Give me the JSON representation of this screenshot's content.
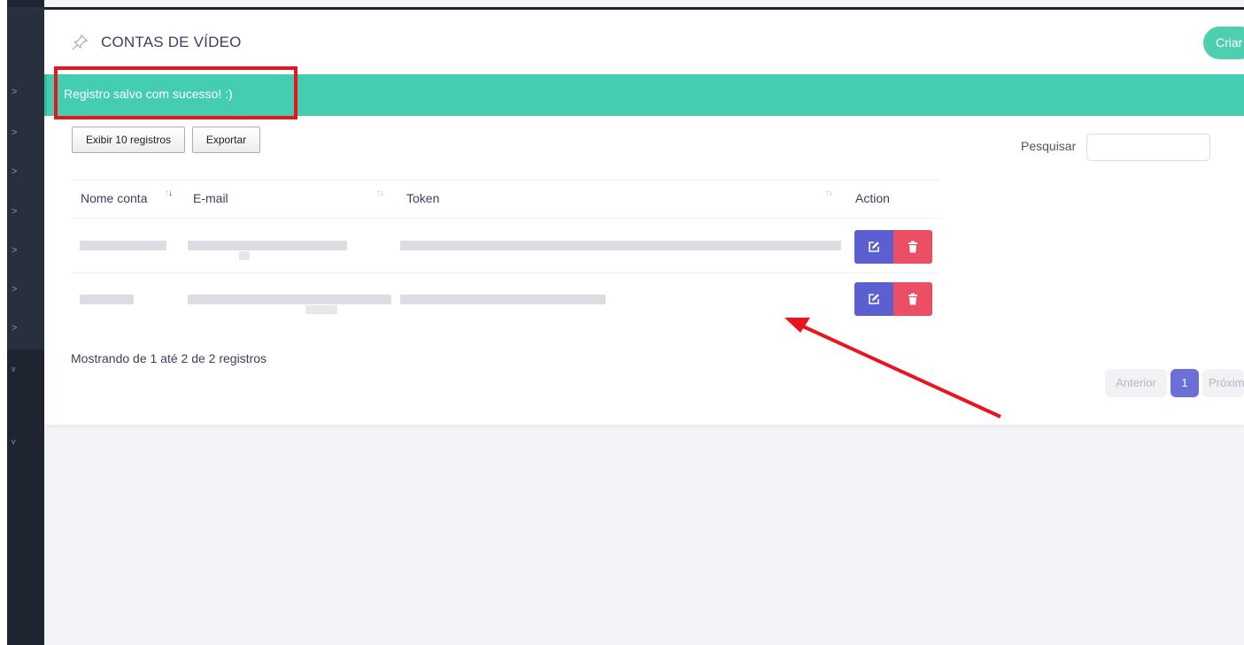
{
  "sidebar": {
    "chevrons": [
      ">",
      ">",
      ">",
      ">",
      ">",
      ">",
      ">",
      "v",
      "v"
    ]
  },
  "header": {
    "title": "CONTAS DE VÍDEO",
    "create_label": "Criar"
  },
  "alert": {
    "message": "Registro salvo com sucesso! :)"
  },
  "toolbar": {
    "show_label": "Exibir 10 registros",
    "export_label": "Exportar",
    "search_label": "Pesquisar",
    "search_value": ""
  },
  "table": {
    "columns": [
      "Nome conta",
      "E-mail",
      "Token",
      "Action"
    ],
    "rows": [
      {
        "nome": "[blurred]",
        "email": "[blurred]",
        "token": "[blurred]"
      },
      {
        "nome": "[blurred]",
        "email": "[blurred]",
        "token": "[blurred]"
      }
    ]
  },
  "footer": {
    "info": "Mostrando de 1 até 2 de 2 registros"
  },
  "pagination": {
    "prev": "Anterior",
    "current": "1",
    "next": "Próximo"
  },
  "colors": {
    "success": "#44cdb0",
    "primary": "#5b5fd1",
    "danger": "#ec4e63",
    "annotation": "#e8141e"
  }
}
